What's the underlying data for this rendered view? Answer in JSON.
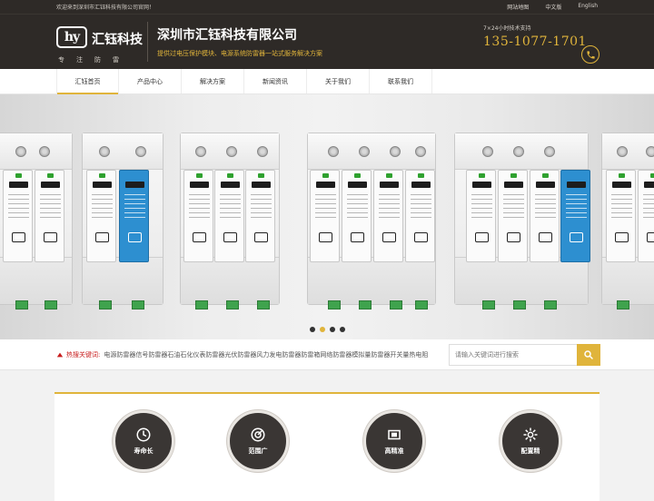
{
  "topbar": {
    "welcome": "欢迎来到深圳市汇钰科技有限公司官网！",
    "links": [
      "网站地图",
      "中文版",
      "English"
    ]
  },
  "header": {
    "logo_mark": "hy",
    "logo_name": "汇钰科技",
    "logo_slogan": "专注防雷",
    "company_name": "深圳市汇钰科技有限公司",
    "tagline": "提供过电压保护模块、电源系统防雷器一站式服务解决方案",
    "hotline_label": "7×24小时技术支持",
    "hotline_number": "135-1077-1701"
  },
  "nav": {
    "items": [
      "汇钰首页",
      "产品中心",
      "解决方案",
      "新闻资讯",
      "关于我们",
      "联系我们"
    ],
    "active_index": 0
  },
  "banner": {
    "slide_count": 4,
    "active_slide": 1
  },
  "search": {
    "hot_label": "热搜关键词:",
    "hot_words": "电源防雷器信号防雷器石油石化仪表防雷器光伏防雷器风力发电防雷器防雷箱网络防雷器模拟量防雷器开关量热电阻",
    "placeholder": "请输入关键词进行搜索"
  },
  "features": [
    {
      "label": "寿命长",
      "icon": "clock-icon"
    },
    {
      "label": "范围广",
      "icon": "radar-icon"
    },
    {
      "label": "高精准",
      "icon": "chip-icon"
    },
    {
      "label": "配置精",
      "icon": "gear-icon"
    }
  ],
  "colors": {
    "accent": "#e0b43b",
    "header_bg": "#2e2a27",
    "hot_red": "#c81e1e"
  }
}
